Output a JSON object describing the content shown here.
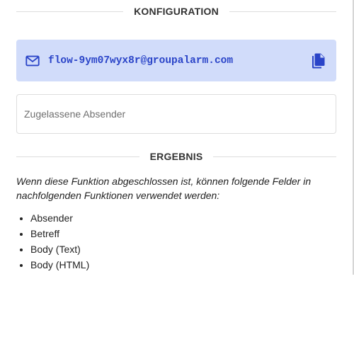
{
  "config": {
    "header": "KONFIGURATION",
    "email": {
      "icon": "mail-icon",
      "address": "flow-9ym07wyx8r@groupalarm.com",
      "copy_icon": "copy-icon",
      "accent": "#2a44c8",
      "background": "#d1dcfa"
    },
    "allowed_senders": {
      "placeholder": "Zugelassene Absender",
      "value": ""
    }
  },
  "result": {
    "header": "ERGEBNIS",
    "description": "Wenn diese Funktion abgeschlossen ist, können folgende Felder in nachfolgenden Funktionen verwendet werden:",
    "fields": [
      "Absender",
      "Betreff",
      "Body (Text)",
      "Body (HTML)"
    ]
  }
}
